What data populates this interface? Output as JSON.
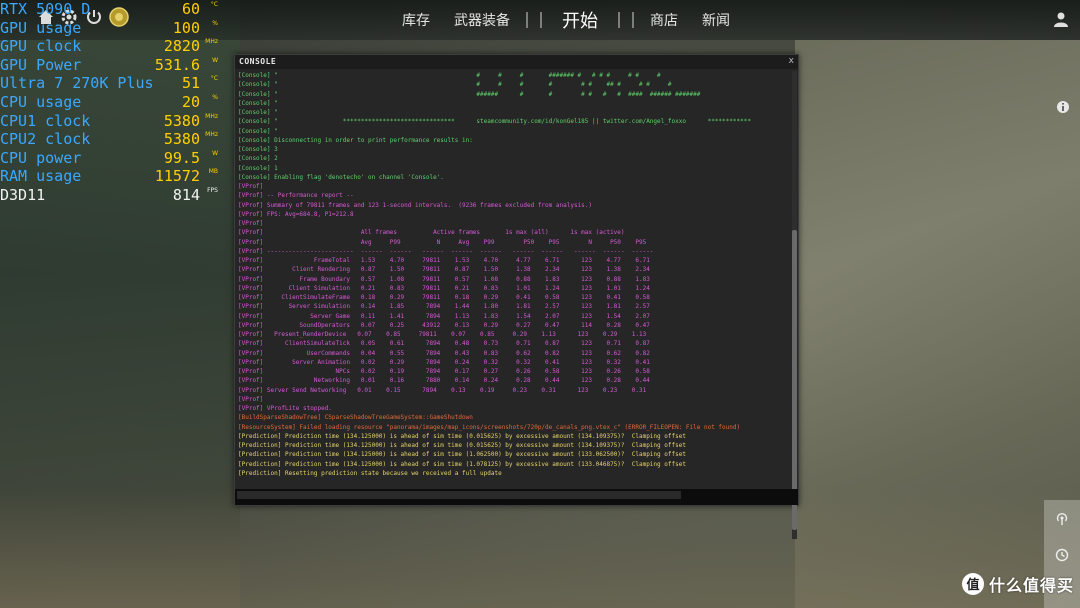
{
  "osd": [
    {
      "label": "RTX 5090 D",
      "value": "60",
      "unit": "°C",
      "color": "#3aa8ff"
    },
    {
      "label": "GPU usage",
      "value": "100",
      "unit": "%",
      "color": "#3aa8ff"
    },
    {
      "label": "GPU clock",
      "value": "2820",
      "unit": "MHz",
      "color": "#3aa8ff"
    },
    {
      "label": "GPU Power",
      "value": "531.6",
      "unit": "W",
      "color": "#3aa8ff"
    },
    {
      "label": "Ultra 7 270K Plus",
      "value": "51",
      "unit": "°C",
      "color": "#3aa8ff"
    },
    {
      "label": "CPU usage",
      "value": "20",
      "unit": "%",
      "color": "#3aa8ff"
    },
    {
      "label": "CPU1 clock",
      "value": "5380",
      "unit": "MHz",
      "color": "#3aa8ff"
    },
    {
      "label": "CPU2 clock",
      "value": "5380",
      "unit": "MHz",
      "color": "#3aa8ff"
    },
    {
      "label": "CPU power",
      "value": "99.5",
      "unit": "W",
      "color": "#3aa8ff"
    },
    {
      "label": "RAM usage",
      "value": "11572",
      "unit": "MB",
      "color": "#3aa8ff"
    },
    {
      "label": "D3D11",
      "value": "814",
      "unit": "FPS",
      "color": "#f2f2f2"
    }
  ],
  "nav": {
    "items": [
      "库存",
      "武器装备",
      "开始",
      "商店",
      "新闻"
    ],
    "active_index": 2
  },
  "console": {
    "title": "CONSOLE",
    "close_label": "x",
    "lines": [
      {
        "c": "green",
        "t": "[Console] \"                                                       #     #     #       ####### #   # # #     # #     #"
      },
      {
        "c": "green",
        "t": "[Console] \"                                                       #     #     #       #        # #    ## #     # #     #"
      },
      {
        "c": "green",
        "t": "[Console] \"                                                       ######      #       #        # #   #   #  ####  ###### #######"
      },
      {
        "c": "green",
        "t": "[Console] \""
      },
      {
        "c": "green",
        "t": "[Console] \""
      },
      {
        "c": "green",
        "t": "[Console] \"                  *******************************      steamcommunity.com/id/konGel185 || twitter.com/Angel_foxxo      ************"
      },
      {
        "c": "green",
        "t": "[Console] \""
      },
      {
        "c": "green",
        "t": "[Console] Disconnecting in order to print performance results in:"
      },
      {
        "c": "green",
        "t": "[Console] 3"
      },
      {
        "c": "green",
        "t": "[Console] 2"
      },
      {
        "c": "green",
        "t": "[Console] 1"
      },
      {
        "c": "green",
        "t": "[Console] Enabling flag 'denotecho' on channel 'Console'."
      },
      {
        "c": "magenta",
        "t": "[VProf]"
      },
      {
        "c": "magenta",
        "t": "[VProf] -- Performance report --"
      },
      {
        "c": "magenta",
        "t": "[VProf] Summary of 79811 frames and 123 1-second intervals.  (9236 frames excluded from analysis.)"
      },
      {
        "c": "magenta",
        "t": "[VProf] FPS: Avg=684.8, P1=212.8"
      },
      {
        "c": "magenta",
        "t": "[VProf]"
      },
      {
        "c": "magenta",
        "t": "[VProf]                           All frames          Active frames       1s max (all)      1s max (active)"
      },
      {
        "c": "magenta",
        "t": "[VProf]                           Avg     P99          N     Avg    P99        P50    P95        N     P50    P95"
      },
      {
        "c": "magenta",
        "t": "[VProf] ------------------------  ------  ------   ------  ------  ------   ------  ------   ------  ------  ------"
      },
      {
        "c": "magenta",
        "t": "[VProf]              FrameTotal   1.53    4.70     79811    1.53    4.70     4.77    6.71      123    4.77    6.71"
      },
      {
        "c": "magenta",
        "t": "[VProf]        Client Rendering   0.87    1.50     79811    0.87    1.50     1.38    2.34      123    1.38    2.34"
      },
      {
        "c": "magenta",
        "t": "[VProf]          Frame Boundary   0.57    1.08     79811    0.57    1.08     0.88    1.83      123    0.88    1.83"
      },
      {
        "c": "magenta",
        "t": "[VProf]       Client Simulation   0.21    0.83     79811    0.21    0.83     1.01    1.24      123    1.01    1.24"
      },
      {
        "c": "magenta",
        "t": "[VProf]     ClientSimulateFrame   0.18    0.29     79811    0.18    0.29     0.41    0.58      123    0.41    0.58"
      },
      {
        "c": "magenta",
        "t": "[VProf]       Server Simulation   0.14    1.85      7894    1.44    1.80     1.81    2.57      123    1.81    2.57"
      },
      {
        "c": "magenta",
        "t": "[VProf]             Server Game   0.11    1.41      7894    1.13    1.83     1.54    2.07      123    1.54    2.07"
      },
      {
        "c": "magenta",
        "t": "[VProf]          SoundOperators   0.07    0.25     43912    0.13    0.29     0.27    0.47      114    0.28    0.47"
      },
      {
        "c": "magenta",
        "t": "[VProf]   Present_RenderDevice   0.07    0.85     79811    0.07    0.85     0.29    1.13      123    0.29    1.13"
      },
      {
        "c": "magenta",
        "t": "[VProf]      ClientSimulateTick   0.05    0.61      7894    0.48    0.73     0.71    0.87      123    0.71    0.87"
      },
      {
        "c": "magenta",
        "t": "[VProf]            UserCommands   0.04    0.55      7894    0.43    0.83     0.62    0.82      123    0.62    0.82"
      },
      {
        "c": "magenta",
        "t": "[VProf]        Server Animation   0.02    0.29      7894    0.24    0.32     0.32    0.41      123    0.32    0.41"
      },
      {
        "c": "magenta",
        "t": "[VProf]                    NPCs   0.02    0.19      7894    0.17    0.27     0.26    0.58      123    0.26    0.58"
      },
      {
        "c": "magenta",
        "t": "[VProf]              Networking   0.01    0.16      7880    0.14    0.24     0.28    0.44      123    0.28    0.44"
      },
      {
        "c": "magenta",
        "t": "[VProf] Server Send Networking   0.01    0.15      7894    0.13    0.19     0.23    0.31      123    0.23    0.31"
      },
      {
        "c": "magenta",
        "t": "[VProf]"
      },
      {
        "c": "magenta",
        "t": "[VProf] VProfLite stopped."
      },
      {
        "c": "orange",
        "t": "[BuildSparseShadowTree] CSparseShadowTreeGameSystem::GameShutdown"
      },
      {
        "c": "orange",
        "t": "[ResourceSystem] Failed loading resource \"panorama/images/map_icons/screenshots/720p/de_canals_png.vtex_c\" (ERROR_FILEOPEN: File not found)"
      },
      {
        "c": "yellow",
        "t": "[Prediction] Prediction time (134.125000) is ahead of sim time (0.015625) by excessive amount (134.109375)?  Clamping offset"
      },
      {
        "c": "yellow",
        "t": "[Prediction] Prediction time (134.125000) is ahead of sim time (0.015625) by excessive amount (134.109375)?  Clamping offset"
      },
      {
        "c": "yellow",
        "t": "[Prediction] Prediction time (134.125000) is ahead of sim time (1.062500) by excessive amount (133.062500)?  Clamping offset"
      },
      {
        "c": "yellow",
        "t": "[Prediction] Prediction time (134.125000) is ahead of sim time (1.078125) by excessive amount (133.046875)?  Clamping offset"
      },
      {
        "c": "yellow",
        "t": "[Prediction] Resetting prediction state because we received a full update"
      }
    ]
  },
  "watermark": {
    "text": "什么值得买"
  }
}
